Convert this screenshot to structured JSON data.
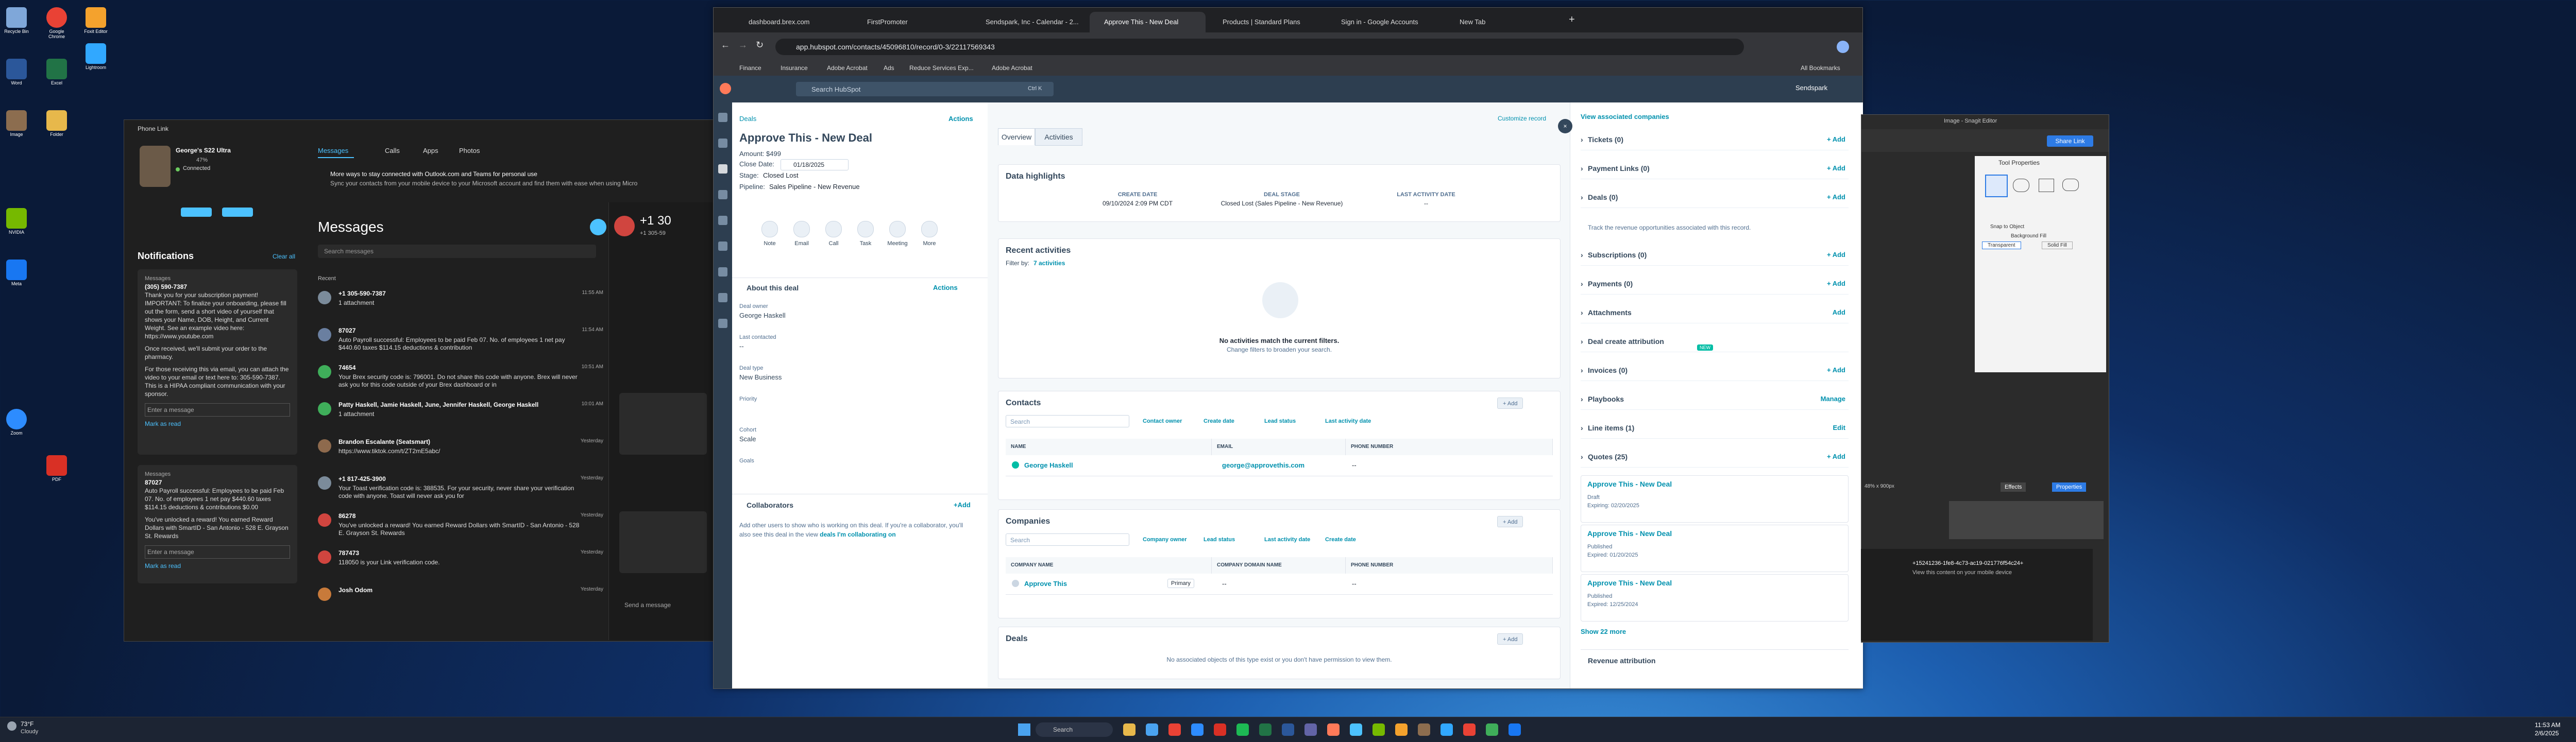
{
  "desktop_icons": [
    {
      "label": "Recycle Bin",
      "color": "#7fa7d9"
    },
    {
      "label": "Google Chrome",
      "color": "#e94235"
    },
    {
      "label": "Foxit Editor",
      "color": "#f4a22d"
    },
    {
      "label": "Lightroom",
      "color": "#31a8ff"
    },
    {
      "label": "Word",
      "color": "#2b579a"
    },
    {
      "label": "Excel",
      "color": "#217346"
    },
    {
      "label": "Image",
      "color": "#8c6d4f"
    },
    {
      "label": "Folder",
      "color": "#e7b84b"
    },
    {
      "label": "NVIDIA",
      "color": "#76b900"
    },
    {
      "label": "Meta",
      "color": "#1877f2"
    },
    {
      "label": "Zoom",
      "color": "#2d8cff"
    },
    {
      "label": "PDF",
      "color": "#d93025"
    }
  ],
  "phone_link": {
    "title": "Phone Link",
    "device": "George's S22 Ultra",
    "battery": "47%",
    "status": "Connected",
    "tabs": [
      "Messages",
      "Calls",
      "Apps",
      "Photos"
    ],
    "banner_title": "More ways to stay connected with Outlook.com and Teams for personal use",
    "banner_text": "Sync your contacts from your mobile device to your Microsoft account and find them with ease when using Micro",
    "notifications_title": "Notifications",
    "clear_all": "Clear all",
    "notifications": [
      {
        "app": "Messages",
        "from": "(305) 590-7387",
        "text": "Thank you for your subscription payment! IMPORTANT: To finalize your onboarding, please fill out the form, send a short video of yourself that shows your Name, DOB, Height, and Current Weight. See an example video here: https://www.youtube.com",
        "extra": "Once received, we'll submit your order to the pharmacy.",
        "extra2": "For those receiving this via email, you can attach the video to your email or text here to: 305-590-7387. This is a HIPAA compliant communication with your sponsor.",
        "reply": "Enter a message",
        "mark": "Mark as read"
      },
      {
        "app": "Messages",
        "from": "87027",
        "text": "Auto Payroll successful: Employees to be paid Feb 07. No. of employees 1 net pay $440.60 taxes $114.15 deductions & contributions $0.00",
        "extra": "You've unlocked a reward! You earned Reward Dollars with SmartID - San Antonio - 528 E. Grayson St. Rewards",
        "extra2": "",
        "reply": "Enter a message",
        "mark": "Mark as read"
      }
    ],
    "messages_title": "Messages",
    "search_placeholder": "Search messages",
    "recent_label": "Recent",
    "messages": [
      {
        "name": "+1 305-590-7387",
        "snippet": "1 attachment",
        "time": "11:55 AM",
        "color": "#7b8b9a"
      },
      {
        "name": "87027",
        "snippet": "Auto Payroll successful: Employees to be paid Feb 07. No. of employees 1 net pay $440.60 taxes $114.15 deductions & contribution",
        "time": "11:54 AM",
        "color": "#6a7fa0"
      },
      {
        "name": "74654",
        "snippet": "Your Brex security code is: 796001. Do not share this code with anyone. Brex will never ask you for this code outside of your Brex dashboard or in",
        "time": "10:51 AM",
        "color": "#3fae5a"
      },
      {
        "name": "Patty Haskell, Jamie Haskell, June, Jennifer Haskell, George Haskell",
        "snippet": "1 attachment",
        "time": "10:01 AM",
        "color": "#3fae5a"
      },
      {
        "name": "Brandon Escalante (Seatsmart)",
        "snippet": "https://www.tiktok.com/t/ZT2mE5abc/",
        "time": "Yesterday",
        "color": "#8e6a4d"
      },
      {
        "name": "+1 817-425-3900",
        "snippet": "Your Toast verification code is: 388535. For your security, never share your verification code with anyone. Toast will never ask you for",
        "time": "Yesterday",
        "color": "#7b8b9a"
      },
      {
        "name": "86278",
        "snippet": "You've unlocked a reward! You earned Reward Dollars with SmartID - San Antonio - 528 E. Grayson St. Rewards",
        "time": "Yesterday",
        "color": "#d0453f"
      },
      {
        "name": "787473",
        "snippet": "118050 is your Link verification code.",
        "time": "Yesterday",
        "color": "#d0453f"
      },
      {
        "name": "Josh Odom",
        "snippet": "",
        "time": "Yesterday",
        "color": "#c87a3a"
      }
    ],
    "conversation_title": "+1 30",
    "conversation_sub": "+1 305-59",
    "send_placeholder": "Send a message"
  },
  "browser": {
    "tabs": [
      {
        "label": "dashboard.brex.com",
        "active": false
      },
      {
        "label": "FirstPromoter",
        "active": false
      },
      {
        "label": "Sendspark, Inc - Calendar - 2...",
        "active": false
      },
      {
        "label": "Approve This - New Deal",
        "active": true
      },
      {
        "label": "Products | Standard Plans",
        "active": false
      },
      {
        "label": "Sign in - Google Accounts",
        "active": false
      },
      {
        "label": "New Tab",
        "active": false
      }
    ],
    "url": "app.hubspot.com/contacts/45096810/record/0-3/22117569343",
    "bookmarks": [
      "Finance",
      "Insurance",
      "Adobe Acrobat",
      "Ads",
      "Reduce Services Exp...",
      "Adobe Acrobat"
    ],
    "all_bookmarks": "All Bookmarks"
  },
  "hubspot": {
    "search_placeholder": "Search HubSpot",
    "search_shortcut": "Ctrl K",
    "account": "Sendspark",
    "back_link": "Deals",
    "actions": "Actions",
    "deal_name": "Approve This - New Deal",
    "amount": "Amount: $499",
    "close_date_label": "Close Date:",
    "close_date": "01/18/2025",
    "stage_label": "Stage:",
    "stage": "Closed Lost",
    "pipeline_label": "Pipeline:",
    "pipeline": "Sales Pipeline - New Revenue",
    "quick_actions": [
      "Note",
      "Email",
      "Call",
      "Task",
      "Meeting",
      "More"
    ],
    "about_title": "About this deal",
    "fields": [
      {
        "label": "Deal owner",
        "value": "George Haskell"
      },
      {
        "label": "Last contacted",
        "value": "--"
      },
      {
        "label": "Deal type",
        "value": "New Business"
      },
      {
        "label": "Priority",
        "value": ""
      },
      {
        "label": "Cohort",
        "value": "Scale"
      },
      {
        "label": "Goals",
        "value": ""
      }
    ],
    "collaborators_title": "Collaborators",
    "collaborators_add": "+Add",
    "collaborators_text": "Add other users to show who is working on this deal. If you're a collaborator, you'll also see this deal in the view",
    "collaborators_link": "deals I'm collaborating on",
    "center_tabs": [
      "Overview",
      "Activities"
    ],
    "customize_record": "Customize record",
    "highlights_title": "Data highlights",
    "highlights": [
      {
        "label": "CREATE DATE",
        "value": "09/10/2024 2:09 PM CDT"
      },
      {
        "label": "DEAL STAGE",
        "value": "Closed Lost (Sales Pipeline - New Revenue)"
      },
      {
        "label": "LAST ACTIVITY DATE",
        "value": "--"
      }
    ],
    "recent_activities_title": "Recent activities",
    "filter_by": "Filter by:",
    "filter_value": "7 activities",
    "no_activities": "No activities match the current filters.",
    "no_activities_sub": "Change filters to broaden your search.",
    "contacts_title": "Contacts",
    "add_label": "+ Add",
    "contacts_filters": [
      "Contact owner",
      "Create date",
      "Lead status",
      "Last activity date"
    ],
    "contacts_columns": [
      "NAME",
      "EMAIL",
      "PHONE NUMBER"
    ],
    "contacts_rows": [
      {
        "name": "George Haskell",
        "email": "george@approvethis.com",
        "phone": "--"
      }
    ],
    "companies_title": "Companies",
    "companies_filters": [
      "Company owner",
      "Lead status",
      "Last activity date",
      "Create date"
    ],
    "companies_columns": [
      "COMPANY NAME",
      "COMPANY DOMAIN NAME",
      "PHONE NUMBER"
    ],
    "companies_rows": [
      {
        "name": "Approve This",
        "badge": "Primary",
        "domain": "--",
        "phone": "--"
      }
    ],
    "deals_title": "Deals",
    "deals_empty": "No associated objects of this type exist or you don't have permission to view them.",
    "search_label": "Search",
    "right_header": "View associated companies",
    "right_sections": [
      {
        "label": "Tickets (0)",
        "action": "+ Add"
      },
      {
        "label": "Payment Links (0)",
        "action": "+ Add"
      },
      {
        "label": "Deals (0)",
        "action": "+ Add"
      },
      {
        "label": "Subscriptions (0)",
        "action": "+ Add"
      },
      {
        "label": "Payments (0)",
        "action": "+ Add"
      },
      {
        "label": "Attachments",
        "action": "Add"
      },
      {
        "label": "Deal create attribution",
        "action": ""
      },
      {
        "label": "Invoices (0)",
        "action": "+ Add"
      },
      {
        "label": "Playbooks",
        "action": "Manage"
      },
      {
        "label": "Line items (1)",
        "action": "Edit"
      },
      {
        "label": "Quotes (25)",
        "action": "+ Add"
      }
    ],
    "deals_section_text": "Track the revenue opportunities associated with this record.",
    "new_badge": "NEW",
    "quotes": [
      {
        "title": "Approve This - New Deal",
        "status": "Draft",
        "expiry": "Expiring: 02/20/2025"
      },
      {
        "title": "Approve This - New Deal",
        "status": "Published",
        "expiry": "Expired: 01/20/2025"
      },
      {
        "title": "Approve This - New Deal",
        "status": "Published",
        "expiry": "Expired: 12/25/2024"
      }
    ],
    "show_more": "Show 22 more",
    "revenue_attribution": "Revenue attribution"
  },
  "snagit": {
    "title": "Image - Snagit Editor",
    "share_link": "Share Link",
    "tool_properties": "Tool Properties",
    "snap_to_object": "Snap to Object",
    "background_fill": "Background Fill",
    "transparent": "Transparent",
    "solid_fill": "Solid Fill",
    "zoom_label": "48% x 900px",
    "effects": "Effects",
    "properties": "Properties",
    "notification_id": "+15241236-1fe8-4c73-ac19-021776f54c24+",
    "notification_text": "View this content on your mobile device"
  },
  "taskbar": {
    "weather_temp": "73°F",
    "weather_text": "Cloudy",
    "search_placeholder": "Search",
    "time": "11:53 AM",
    "date": "2/6/2025"
  },
  "colors": {
    "hubspot_accent": "#0091ae",
    "hubspot_nav": "#2d3e50",
    "phone_accent": "#4cc2ff"
  }
}
